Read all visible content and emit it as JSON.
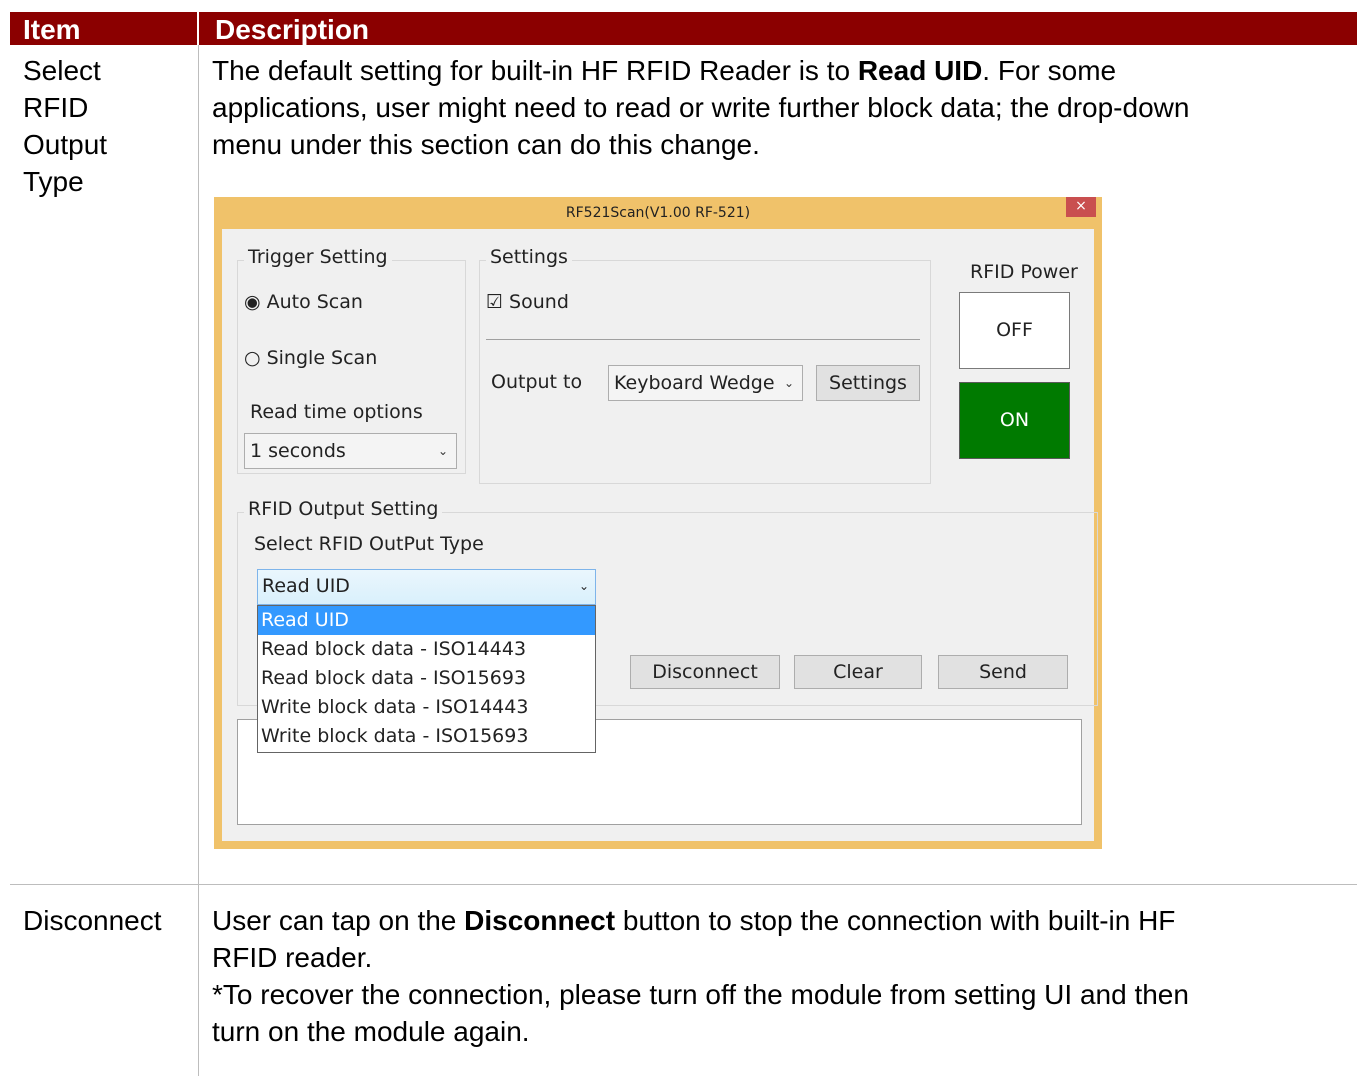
{
  "table": {
    "header": {
      "item": "Item",
      "description": "Description"
    },
    "rows": [
      {
        "item_lines": [
          "Select",
          "RFID",
          "Output",
          "Type"
        ],
        "desc_lines": [
          "The default setting for built-in HF RFID Reader is to ",
          "Read UID",
          ". For some",
          "applications, user might need to read or write further block data; the drop-down",
          "menu under this section can do this change."
        ]
      },
      {
        "item": "Disconnect",
        "desc_a": "User can tap on the ",
        "desc_b": "Disconnect",
        "desc_c": " button to stop the connection with built-in HF",
        "desc_d": "RFID reader.",
        "desc_e": "*To recover the connection, please turn off the module from setting UI and then",
        "desc_f": "turn on the module again."
      }
    ]
  },
  "window": {
    "title": "RF521Scan(V1.00 RF-521)",
    "close": "×",
    "trigger": {
      "title": "Trigger Setting",
      "auto_scan": "Auto Scan",
      "single_scan": "Single Scan",
      "selected": "Auto Scan",
      "read_time_label": "Read time options",
      "read_time_value": "1 seconds"
    },
    "settings": {
      "title": "Settings",
      "sound_label": "Sound",
      "sound_checked": true,
      "output_to_label": "Output to",
      "output_to_value": "Keyboard Wedge",
      "settings_button": "Settings"
    },
    "power": {
      "title": "RFID Power",
      "off_label": "OFF",
      "on_label": "ON",
      "on_color": "#007a00"
    },
    "rfid_output": {
      "title": "RFID Output Setting",
      "select_label": "Select RFID OutPut Type",
      "selected_value": "Read UID",
      "options": [
        "Read UID",
        "Read block data - ISO14443",
        "Read block data - ISO15693",
        "Write block data - ISO14443",
        "Write block data - ISO15693"
      ],
      "highlighted_index": 0,
      "highlight_color": "#3399ff"
    },
    "actions": {
      "disconnect": "Disconnect",
      "clear": "Clear",
      "send": "Send"
    }
  },
  "colors": {
    "header_bg": "#8b0000",
    "window_frame": "#f0c26a"
  }
}
